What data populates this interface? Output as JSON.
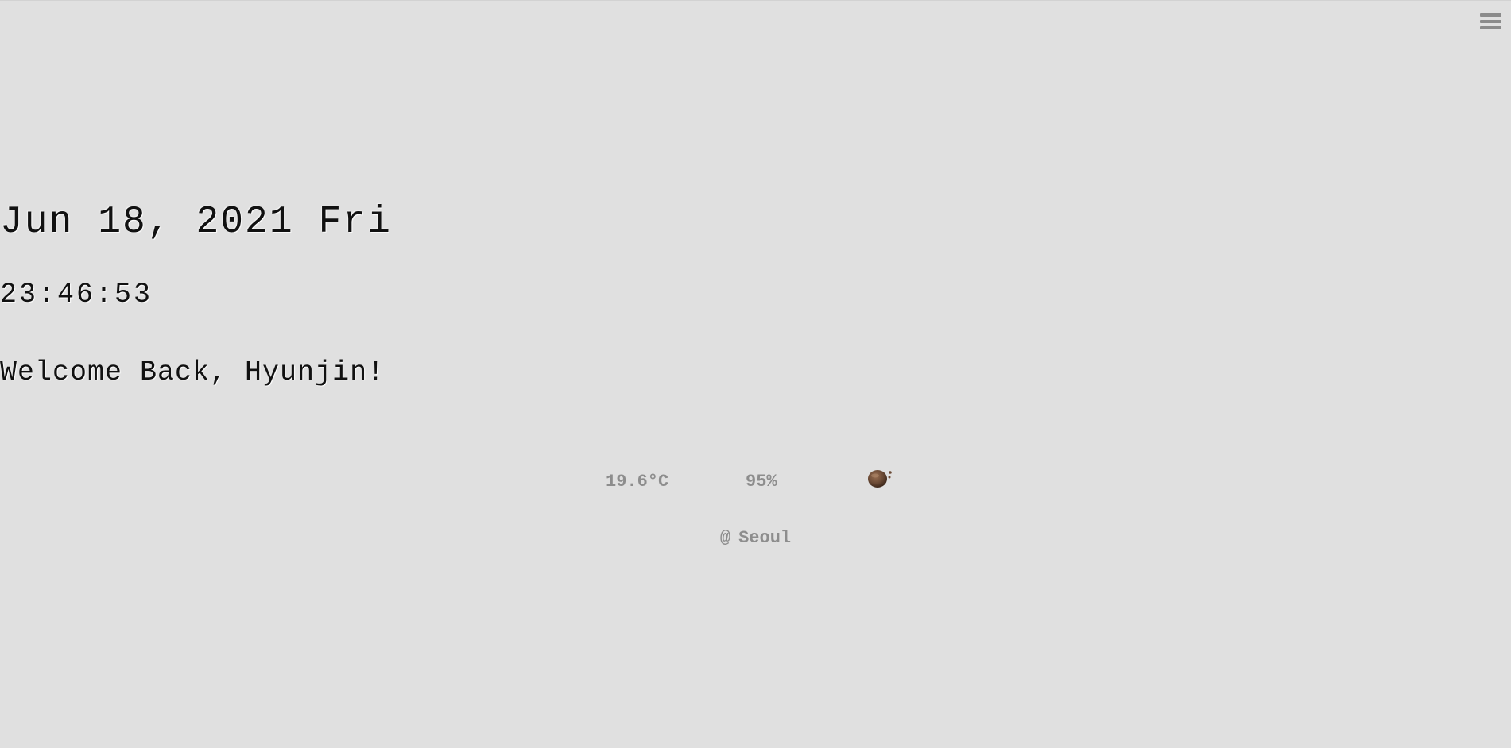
{
  "clock": {
    "date": "Jun 18, 2021 Fri",
    "time": "23:46:53"
  },
  "greeting": {
    "text": "Welcome Back, Hyunjin!"
  },
  "weather": {
    "temperature": "19.6°C",
    "humidity": "95%",
    "icon": "rain-cloud-icon",
    "location_prefix": "@",
    "location": "Seoul"
  },
  "menu": {
    "icon": "hamburger-menu-icon"
  },
  "colors": {
    "background": "#e0e0e0",
    "text": "#111111",
    "muted": "#8d8d8d",
    "icon_brown": "#6b4a35"
  }
}
